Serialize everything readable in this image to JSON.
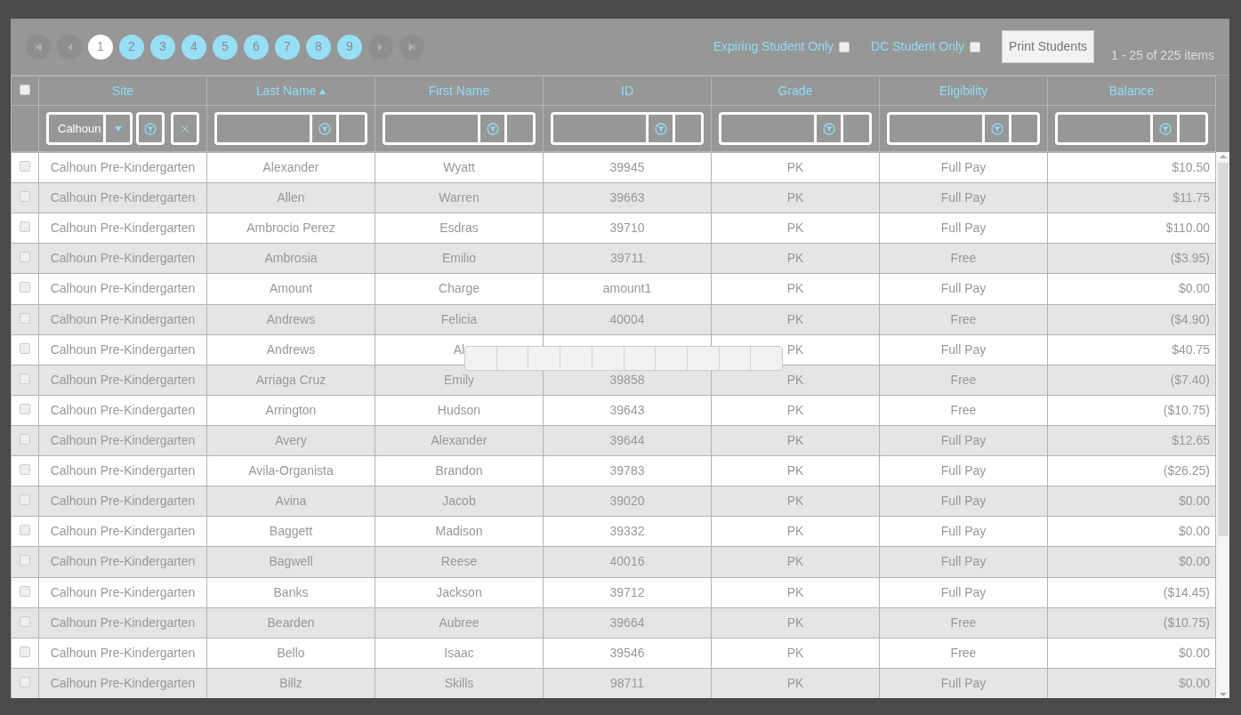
{
  "pager": {
    "pages": [
      {
        "label": "1",
        "selected": true
      },
      {
        "label": "2",
        "selected": false
      },
      {
        "label": "3",
        "selected": false
      },
      {
        "label": "4",
        "selected": false
      },
      {
        "label": "5",
        "selected": false
      },
      {
        "label": "6",
        "selected": false
      },
      {
        "label": "7",
        "selected": false
      },
      {
        "label": "8",
        "selected": false
      },
      {
        "label": "9",
        "selected": false
      }
    ]
  },
  "filters": [
    {
      "label": "Expiring Student Only",
      "checked": false
    },
    {
      "label": "DC Student Only",
      "checked": false
    }
  ],
  "print_button": "Print Students",
  "item_count": "1 - 25 of 225 items",
  "table": {
    "select_all_checked": false,
    "columns": [
      {
        "label": "Site",
        "sorted": false,
        "kind": "dropdown",
        "value": "Calhoun"
      },
      {
        "label": "Last Name",
        "sorted": true,
        "kind": "text"
      },
      {
        "label": "First Name",
        "sorted": false,
        "kind": "text"
      },
      {
        "label": "ID",
        "sorted": false,
        "kind": "text"
      },
      {
        "label": "Grade",
        "sorted": false,
        "kind": "text"
      },
      {
        "label": "Eligibility",
        "sorted": false,
        "kind": "text"
      },
      {
        "label": "Balance",
        "sorted": false,
        "kind": "text"
      }
    ],
    "rows": [
      {
        "checked": false,
        "cells": [
          "Calhoun Pre-Kindergarten",
          "Alexander",
          "Wyatt",
          "39945",
          "PK",
          "Full Pay",
          "$10.50"
        ]
      },
      {
        "checked": false,
        "cells": [
          "Calhoun Pre-Kindergarten",
          "Allen",
          "Warren",
          "39663",
          "PK",
          "Full Pay",
          "$11.75"
        ]
      },
      {
        "checked": false,
        "cells": [
          "Calhoun Pre-Kindergarten",
          "Ambrocio Perez",
          "Esdras",
          "39710",
          "PK",
          "Full Pay",
          "$110.00"
        ]
      },
      {
        "checked": false,
        "cells": [
          "Calhoun Pre-Kindergarten",
          "Ambrosia",
          "Emilio",
          "39711",
          "PK",
          "Free",
          "($3.95)"
        ]
      },
      {
        "checked": false,
        "cells": [
          "Calhoun Pre-Kindergarten",
          "Amount",
          "Charge",
          "amount1",
          "PK",
          "Full Pay",
          "$0.00"
        ]
      },
      {
        "checked": false,
        "cells": [
          "Calhoun Pre-Kindergarten",
          "Andrews",
          "Felicia",
          "40004",
          "PK",
          "Free",
          "($4.90)"
        ]
      },
      {
        "checked": false,
        "cells": [
          "Calhoun Pre-Kindergarten",
          "Andrews",
          "Al",
          null,
          "PK",
          "Full Pay",
          "$40.75"
        ]
      },
      {
        "checked": false,
        "cells": [
          "Calhoun Pre-Kindergarten",
          "Arriaga Cruz",
          "Emily",
          "39858",
          "PK",
          "Free",
          "($7.40)"
        ]
      },
      {
        "checked": false,
        "cells": [
          "Calhoun Pre-Kindergarten",
          "Arrington",
          "Hudson",
          "39643",
          "PK",
          "Free",
          "($10.75)"
        ]
      },
      {
        "checked": false,
        "cells": [
          "Calhoun Pre-Kindergarten",
          "Avery",
          "Alexander",
          "39644",
          "PK",
          "Full Pay",
          "$12.65"
        ]
      },
      {
        "checked": false,
        "cells": [
          "Calhoun Pre-Kindergarten",
          "Avila-Organista",
          "Brandon",
          "39783",
          "PK",
          "Full Pay",
          "($26.25)"
        ]
      },
      {
        "checked": false,
        "cells": [
          "Calhoun Pre-Kindergarten",
          "Avina",
          "Jacob",
          "39020",
          "PK",
          "Full Pay",
          "$0.00"
        ]
      },
      {
        "checked": false,
        "cells": [
          "Calhoun Pre-Kindergarten",
          "Baggett",
          "Madison",
          "39332",
          "PK",
          "Full Pay",
          "$0.00"
        ]
      },
      {
        "checked": false,
        "cells": [
          "Calhoun Pre-Kindergarten",
          "Bagwell",
          "Reese",
          "40016",
          "PK",
          "Full Pay",
          "$0.00"
        ]
      },
      {
        "checked": false,
        "cells": [
          "Calhoun Pre-Kindergarten",
          "Banks",
          "Jackson",
          "39712",
          "PK",
          "Full Pay",
          "($14.45)"
        ]
      },
      {
        "checked": false,
        "cells": [
          "Calhoun Pre-Kindergarten",
          "Bearden",
          "Aubree",
          "39664",
          "PK",
          "Free",
          "($10.75)"
        ]
      },
      {
        "checked": false,
        "cells": [
          "Calhoun Pre-Kindergarten",
          "Bello",
          "Isaac",
          "39546",
          "PK",
          "Free",
          "$0.00"
        ]
      },
      {
        "checked": false,
        "cells": [
          "Calhoun Pre-Kindergarten",
          "Billz",
          "Skills",
          "98711",
          "PK",
          "Full Pay",
          "$0.00"
        ]
      }
    ]
  }
}
